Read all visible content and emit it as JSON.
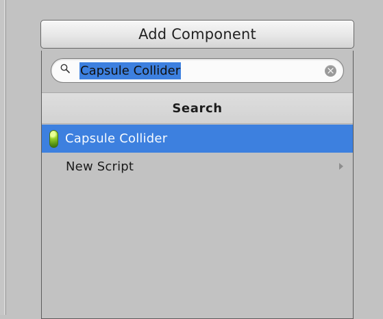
{
  "inspector": {
    "add_component_button": {
      "label": "Add Component"
    },
    "popup": {
      "search": {
        "value": "Capsule Collider",
        "icon": "search-icon",
        "clear_icon": "clear-icon",
        "clear_symbol": "×"
      },
      "header": {
        "title": "Search"
      },
      "results": [
        {
          "label": "Capsule Collider",
          "icon": "capsule-collider-icon",
          "selected": true,
          "selected_color": "#3d80df"
        },
        {
          "label": "New Script",
          "icon": "submenu-arrow-icon",
          "has_submenu": true
        }
      ]
    }
  }
}
